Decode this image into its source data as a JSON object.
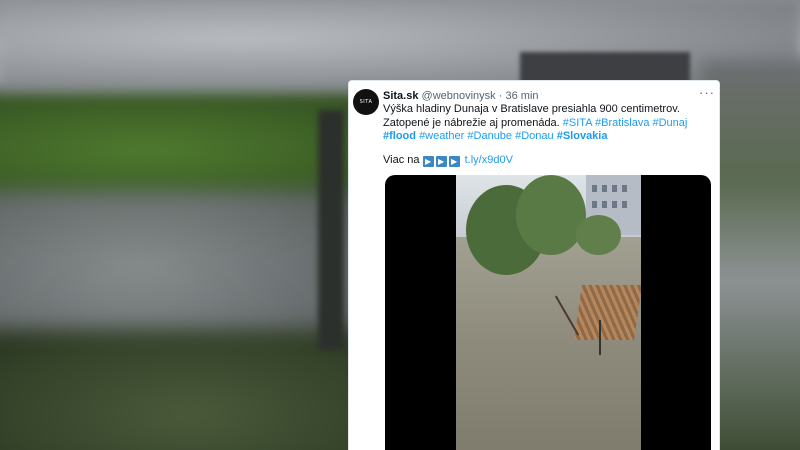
{
  "tweet": {
    "display_name": "Sita.sk",
    "handle": "@webnovinysk",
    "separator": "·",
    "time": "36 min",
    "more": "···",
    "avatar_text": "SITA",
    "text_plain": "Výška hladiny Dunaja v Bratislave presiahla 900 centimetrov. Zatopené je nábrežie aj promenáda.",
    "hashtags": [
      "#SITA",
      "#Bratislava",
      "#Dunaj",
      "#flood",
      "#weather",
      "#Danube",
      "#Donau",
      "#Slovakia"
    ],
    "more_label": "Viac na",
    "arrow_glyph": "▶",
    "link": "t.ly/x9d0V"
  },
  "colors": {
    "link": "#1d9bf0",
    "text": "#0f1419",
    "muted": "#536471",
    "arrow_emoji": "#3b88c3"
  }
}
